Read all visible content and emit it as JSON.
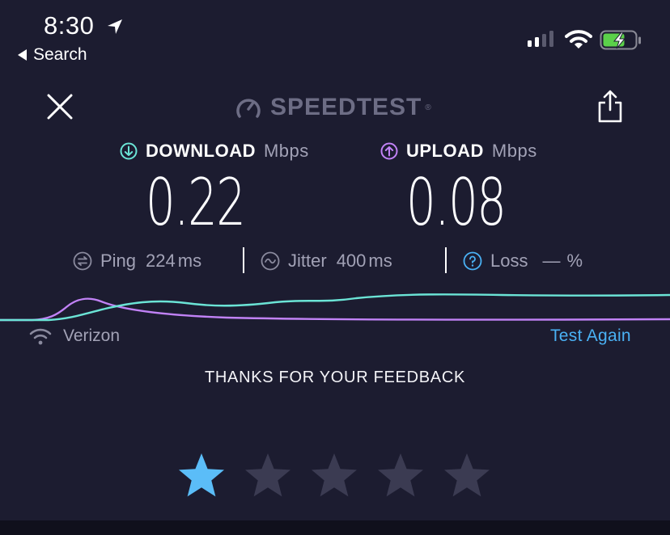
{
  "status_bar": {
    "time": "8:30",
    "back_label": "Search",
    "signal_bars": 4,
    "signal_bars_active": 2,
    "battery_charging": true
  },
  "header": {
    "brand": "SPEEDTEST",
    "trademark": "®",
    "close_icon": "close-icon",
    "share_icon": "share-icon"
  },
  "download": {
    "label": "DOWNLOAD",
    "unit": "Mbps",
    "value": "0.22",
    "color": "#6be4d6"
  },
  "upload": {
    "label": "UPLOAD",
    "unit": "Mbps",
    "value": "0.08",
    "color": "#c182f6"
  },
  "stats": {
    "ping": {
      "label": "Ping",
      "value": "224",
      "unit": "ms"
    },
    "jitter": {
      "label": "Jitter",
      "value": "400",
      "unit": "ms"
    },
    "loss": {
      "label": "Loss",
      "value": "—",
      "unit": "%"
    }
  },
  "isp": {
    "name": "Verizon",
    "icon": "wifi-icon"
  },
  "test_again_label": "Test Again",
  "feedback_text": "THANKS FOR YOUR FEEDBACK",
  "rating": {
    "value": 1,
    "max": 5,
    "active_color": "#5bbdf8",
    "inactive_color": "#3b3b52"
  },
  "colors": {
    "background": "#1c1c30",
    "accent": "#4ab1f4",
    "muted": "#a2a2b6"
  }
}
